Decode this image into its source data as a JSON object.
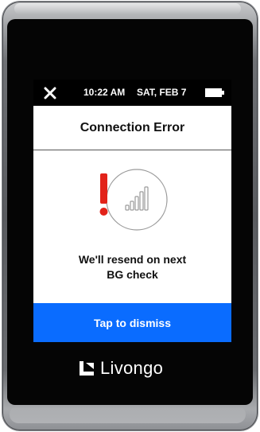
{
  "status_bar": {
    "time": "10:22 AM",
    "date": "SAT, FEB 7"
  },
  "dialog": {
    "title": "Connection Error",
    "message_line1": "We'll resend on next",
    "message_line2": "BG check",
    "dismiss_label": "Tap to dismiss"
  },
  "brand": {
    "name": "Livongo"
  },
  "icons": {
    "close": "close-icon",
    "battery": "battery-icon",
    "error": "exclamation-icon",
    "signal": "signal-bars-icon",
    "logo": "livongo-logo-icon"
  },
  "colors": {
    "accent": "#0a6cff",
    "error": "#e2231a",
    "signal_gray": "#9a9a9a"
  }
}
